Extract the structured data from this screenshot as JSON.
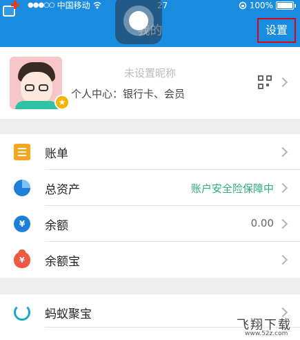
{
  "status_bar": {
    "carrier": "中国移动",
    "time": "27",
    "battery": "100%"
  },
  "header": {
    "title": "我的",
    "settings_label": "设置"
  },
  "profile": {
    "nickname": "未设置昵称",
    "subtitle": "个人中心：银行卡、会员"
  },
  "menu": [
    {
      "label": "账单",
      "value": "",
      "icon": "bill-icon"
    },
    {
      "label": "总资产",
      "value": "账户安全险保障中",
      "icon": "pie-chart-icon"
    },
    {
      "label": "余额",
      "value": "0.00",
      "icon": "yuan-coin-icon"
    },
    {
      "label": "余额宝",
      "value": "",
      "icon": "money-bag-icon"
    },
    {
      "label": "蚂蚁聚宝",
      "value": "",
      "icon": "ant-fortune-icon"
    }
  ],
  "colors": {
    "header_blue": "#1a8ce0",
    "highlight_red": "#e0001a",
    "safety_green": "#2fae7d"
  },
  "watermark": {
    "title": "飞翔下载",
    "url": "www.52z.com"
  }
}
